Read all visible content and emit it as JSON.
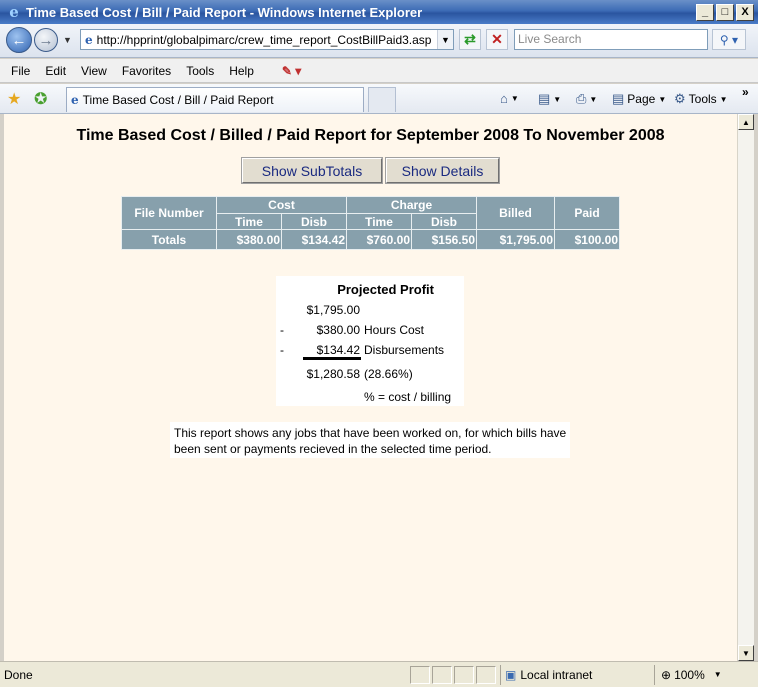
{
  "window": {
    "title": "Time Based Cost / Bill / Paid Report - Windows Internet Explorer",
    "buttons": {
      "minimize": "_",
      "maximize": "□",
      "close": "X"
    }
  },
  "nav": {
    "url": "http://hpprint/globalpimarc/crew_time_report_CostBillPaid3.asp",
    "search_placeholder": "Live Search"
  },
  "menu": {
    "items": [
      "File",
      "Edit",
      "View",
      "Favorites",
      "Tools",
      "Help"
    ]
  },
  "tabs": {
    "active_label": "Time Based Cost / Bill / Paid Report"
  },
  "commands": {
    "page": "Page",
    "tools": "Tools"
  },
  "report": {
    "title": "Time Based Cost / Billed / Paid Report for September 2008 To November 2008",
    "buttons": {
      "subtotals": "Show SubTotals",
      "details": "Show Details"
    },
    "table": {
      "headers": {
        "file_number": "File Number",
        "cost": "Cost",
        "charge": "Charge",
        "time": "Time",
        "disb": "Disb",
        "billed": "Billed",
        "paid": "Paid"
      },
      "totals": {
        "label": "Totals",
        "cost_time": "$380.00",
        "cost_disb": "$134.42",
        "charge_time": "$760.00",
        "charge_disb": "$156.50",
        "billed": "$1,795.00",
        "paid": "$100.00"
      }
    },
    "profit": {
      "title": "Projected Profit",
      "billed": "$1,795.00",
      "hours_sign": "-",
      "hours_cost": "$380.00",
      "hours_label": "Hours Cost",
      "disb_sign": "-",
      "disb_cost": "$134.42",
      "disb_label": "Disbursements",
      "result": "$1,280.58",
      "percent": "(28.66%)",
      "formula": "% = cost / billing"
    },
    "note": "This report shows any jobs that have been worked on, for which bills have been sent or payments recieved in the selected time period."
  },
  "status": {
    "text": "Done",
    "zone": "Local intranet",
    "zoom": "100%"
  }
}
